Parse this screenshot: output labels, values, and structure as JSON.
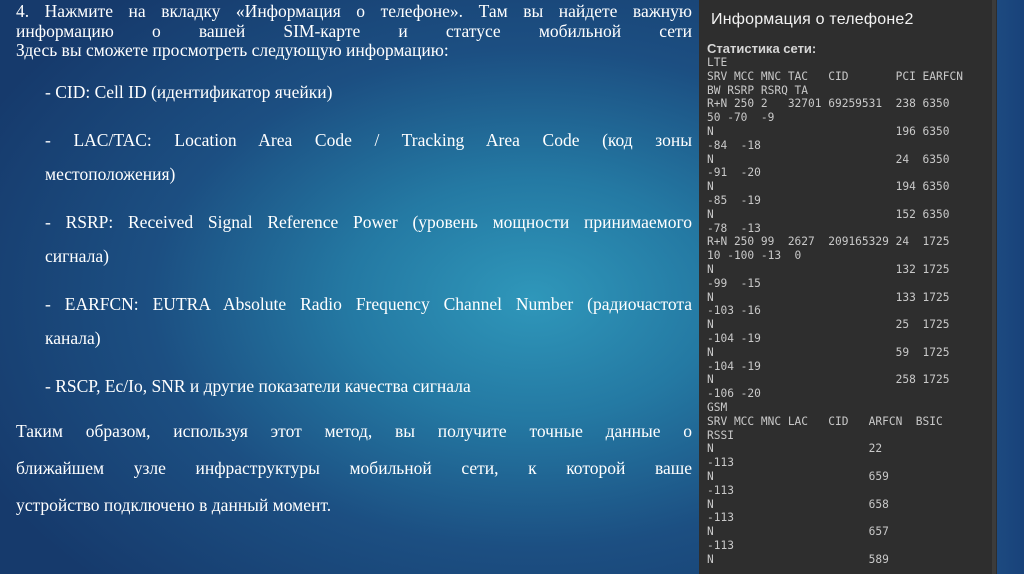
{
  "slide": {
    "intro_line1": "4. Нажмите на вкладку «Информация о телефоне». Там вы найдете важную",
    "intro_line2": "информацию о вашей SIM-карте и статусе мобильной сети",
    "intro_line3": "Здесь вы сможете просмотреть следующую информацию:",
    "bullets": [
      {
        "line1": "- CID: Cell ID (идентификатор ячейки)",
        "line2": ""
      },
      {
        "line1": "- LAC/TAC: Location Area Code / Tracking Area Code (код зоны",
        "line2": "местоположения)"
      },
      {
        "line1": "- RSRP: Received Signal Reference Power (уровень мощности принимаемого",
        "line2": "сигнала)"
      },
      {
        "line1": "- EARFCN: EUTRA Absolute Radio Frequency Channel Number (радиочастота",
        "line2": "канала)"
      },
      {
        "line1": "- RSCP, Ec/Io, SNR и другие показатели качества сигнала",
        "line2": ""
      }
    ],
    "conclusion_line1": "Таким образом, используя этот метод, вы получите точные данные о",
    "conclusion_line2": "ближайшем узле инфраструктуры мобильной сети, к которой ваше",
    "conclusion_line3": "устройство подключено в данный момент."
  },
  "phone": {
    "title": "Информация о телефоне2",
    "stats_title": "Статистика сети:",
    "lines": [
      "LTE",
      "SRV MCC MNC TAC   CID       PCI EARFCN",
      "BW RSRP RSRQ TA",
      "R+N 250 2   32701 69259531  238 6350",
      "50 -70  -9",
      "N                           196 6350",
      "-84  -18",
      "N                           24  6350",
      "-91  -20",
      "N                           194 6350",
      "-85  -19",
      "N                           152 6350",
      "-78  -13",
      "R+N 250 99  2627  209165329 24  1725",
      "10 -100 -13  0",
      "N                           132 1725",
      "-99  -15",
      "N                           133 1725",
      "-103 -16",
      "N                           25  1725",
      "-104 -19",
      "N                           59  1725",
      "-104 -19",
      "N                           258 1725",
      "-106 -20",
      "GSM",
      "SRV MCC MNC LAC   CID   ARFCN  BSIC",
      "RSSI",
      "N                       22",
      "-113",
      "N                       659",
      "-113",
      "N                       658",
      "-113",
      "N                       657",
      "-113",
      "N                       589"
    ]
  },
  "colors": {
    "background_center": "#2f97ba",
    "background_edge": "#163a6c",
    "phone_bg": "#2e2e2e",
    "text": "#ffffff"
  }
}
